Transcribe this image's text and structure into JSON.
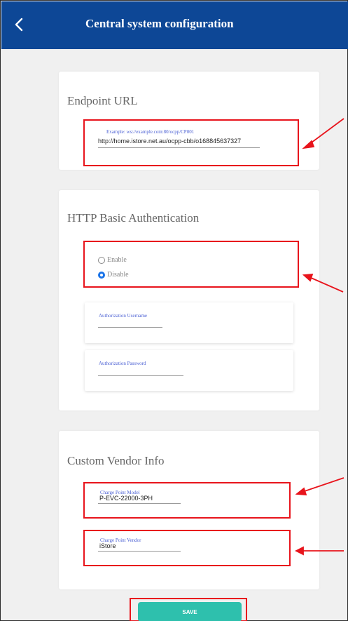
{
  "header": {
    "title": "Central system configuration",
    "back_icon": "chevron-left-icon"
  },
  "endpoint": {
    "title": "Endpoint URL",
    "placeholder": "Example: ws://example.com:80/ocpp/CP001",
    "value": "http://home.istore.net.au/ocpp-cbb/o168845637327"
  },
  "auth": {
    "title": "HTTP Basic Authentication",
    "options": [
      "Enable",
      "Disable"
    ],
    "selected": "Disable",
    "username_label": "Authorization Username",
    "password_label": "Authorization Password"
  },
  "vendor": {
    "title": "Custom Vendor Info",
    "model_label": "Charge Point Model",
    "model_value": "P-EVC-22000-3PH",
    "vendor_label": "Charge Point Vendor",
    "vendor_value": "iStore"
  },
  "save_label": "SAVE",
  "colors": {
    "header": "#0d4796",
    "highlight": "#e8141c",
    "save": "#2ec0ad",
    "radio_selected": "#1a73e8"
  }
}
